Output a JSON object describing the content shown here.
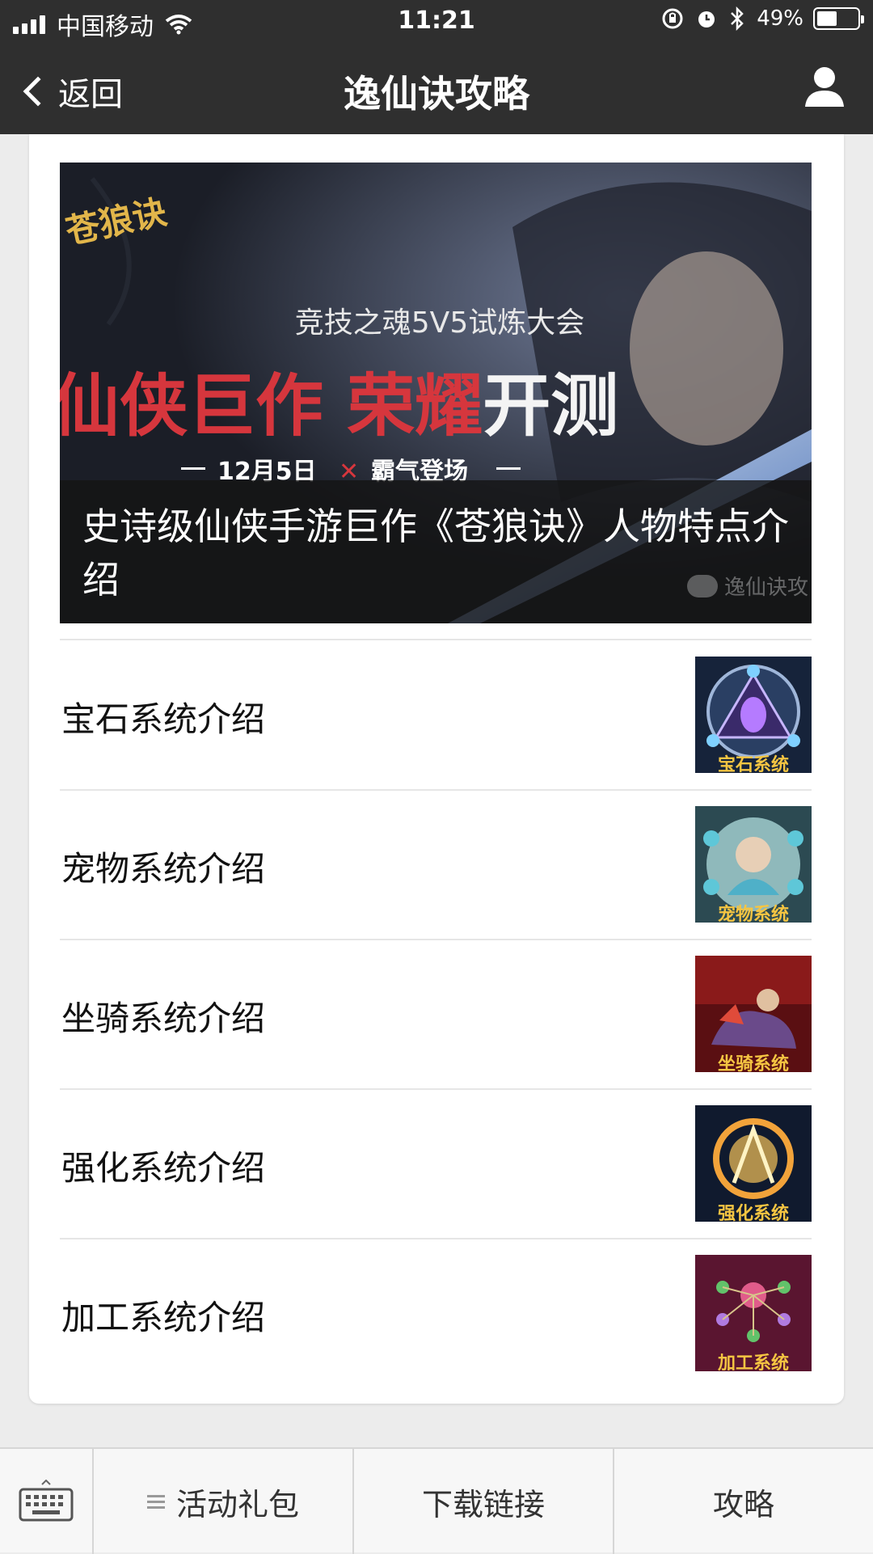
{
  "status_bar": {
    "carrier": "中国移动",
    "time": "11:21",
    "battery_text": "49%",
    "battery_level": 0.49,
    "icons": [
      "signal-icon",
      "wifi-icon",
      "orientation-lock-icon",
      "alarm-icon",
      "bluetooth-icon",
      "battery-icon"
    ]
  },
  "nav": {
    "back_label": "返回",
    "title": "逸仙诀攻略",
    "right_icon": "user-profile-icon"
  },
  "hero": {
    "caption": "史诗级仙侠手游巨作《苍狼诀》人物特点介绍",
    "banner_logo": "苍狼诀",
    "banner_subtitle": "竞技之魂5V5试炼大会",
    "banner_headline_red": "仙侠巨作 荣耀",
    "banner_headline_white": "开测",
    "banner_date_left": "12月5日",
    "banner_date_right": "霸气登场",
    "banner_x_mark": "✕",
    "watermark": "逸仙诀攻"
  },
  "articles": [
    {
      "title": "宝石系统介绍",
      "thumb_label": "宝石系统"
    },
    {
      "title": "宠物系统介绍",
      "thumb_label": "宠物系统"
    },
    {
      "title": "坐骑系统介绍",
      "thumb_label": "坐骑系统"
    },
    {
      "title": "强化系统介绍",
      "thumb_label": "强化系统"
    },
    {
      "title": "加工系统介绍",
      "thumb_label": "加工系统"
    }
  ],
  "tabbar": {
    "keyboard_icon": "keyboard-icon",
    "menu_icon": "menu-lines-icon",
    "tabs": [
      {
        "label": "活动礼包"
      },
      {
        "label": "下载链接"
      },
      {
        "label": "攻略"
      }
    ]
  }
}
